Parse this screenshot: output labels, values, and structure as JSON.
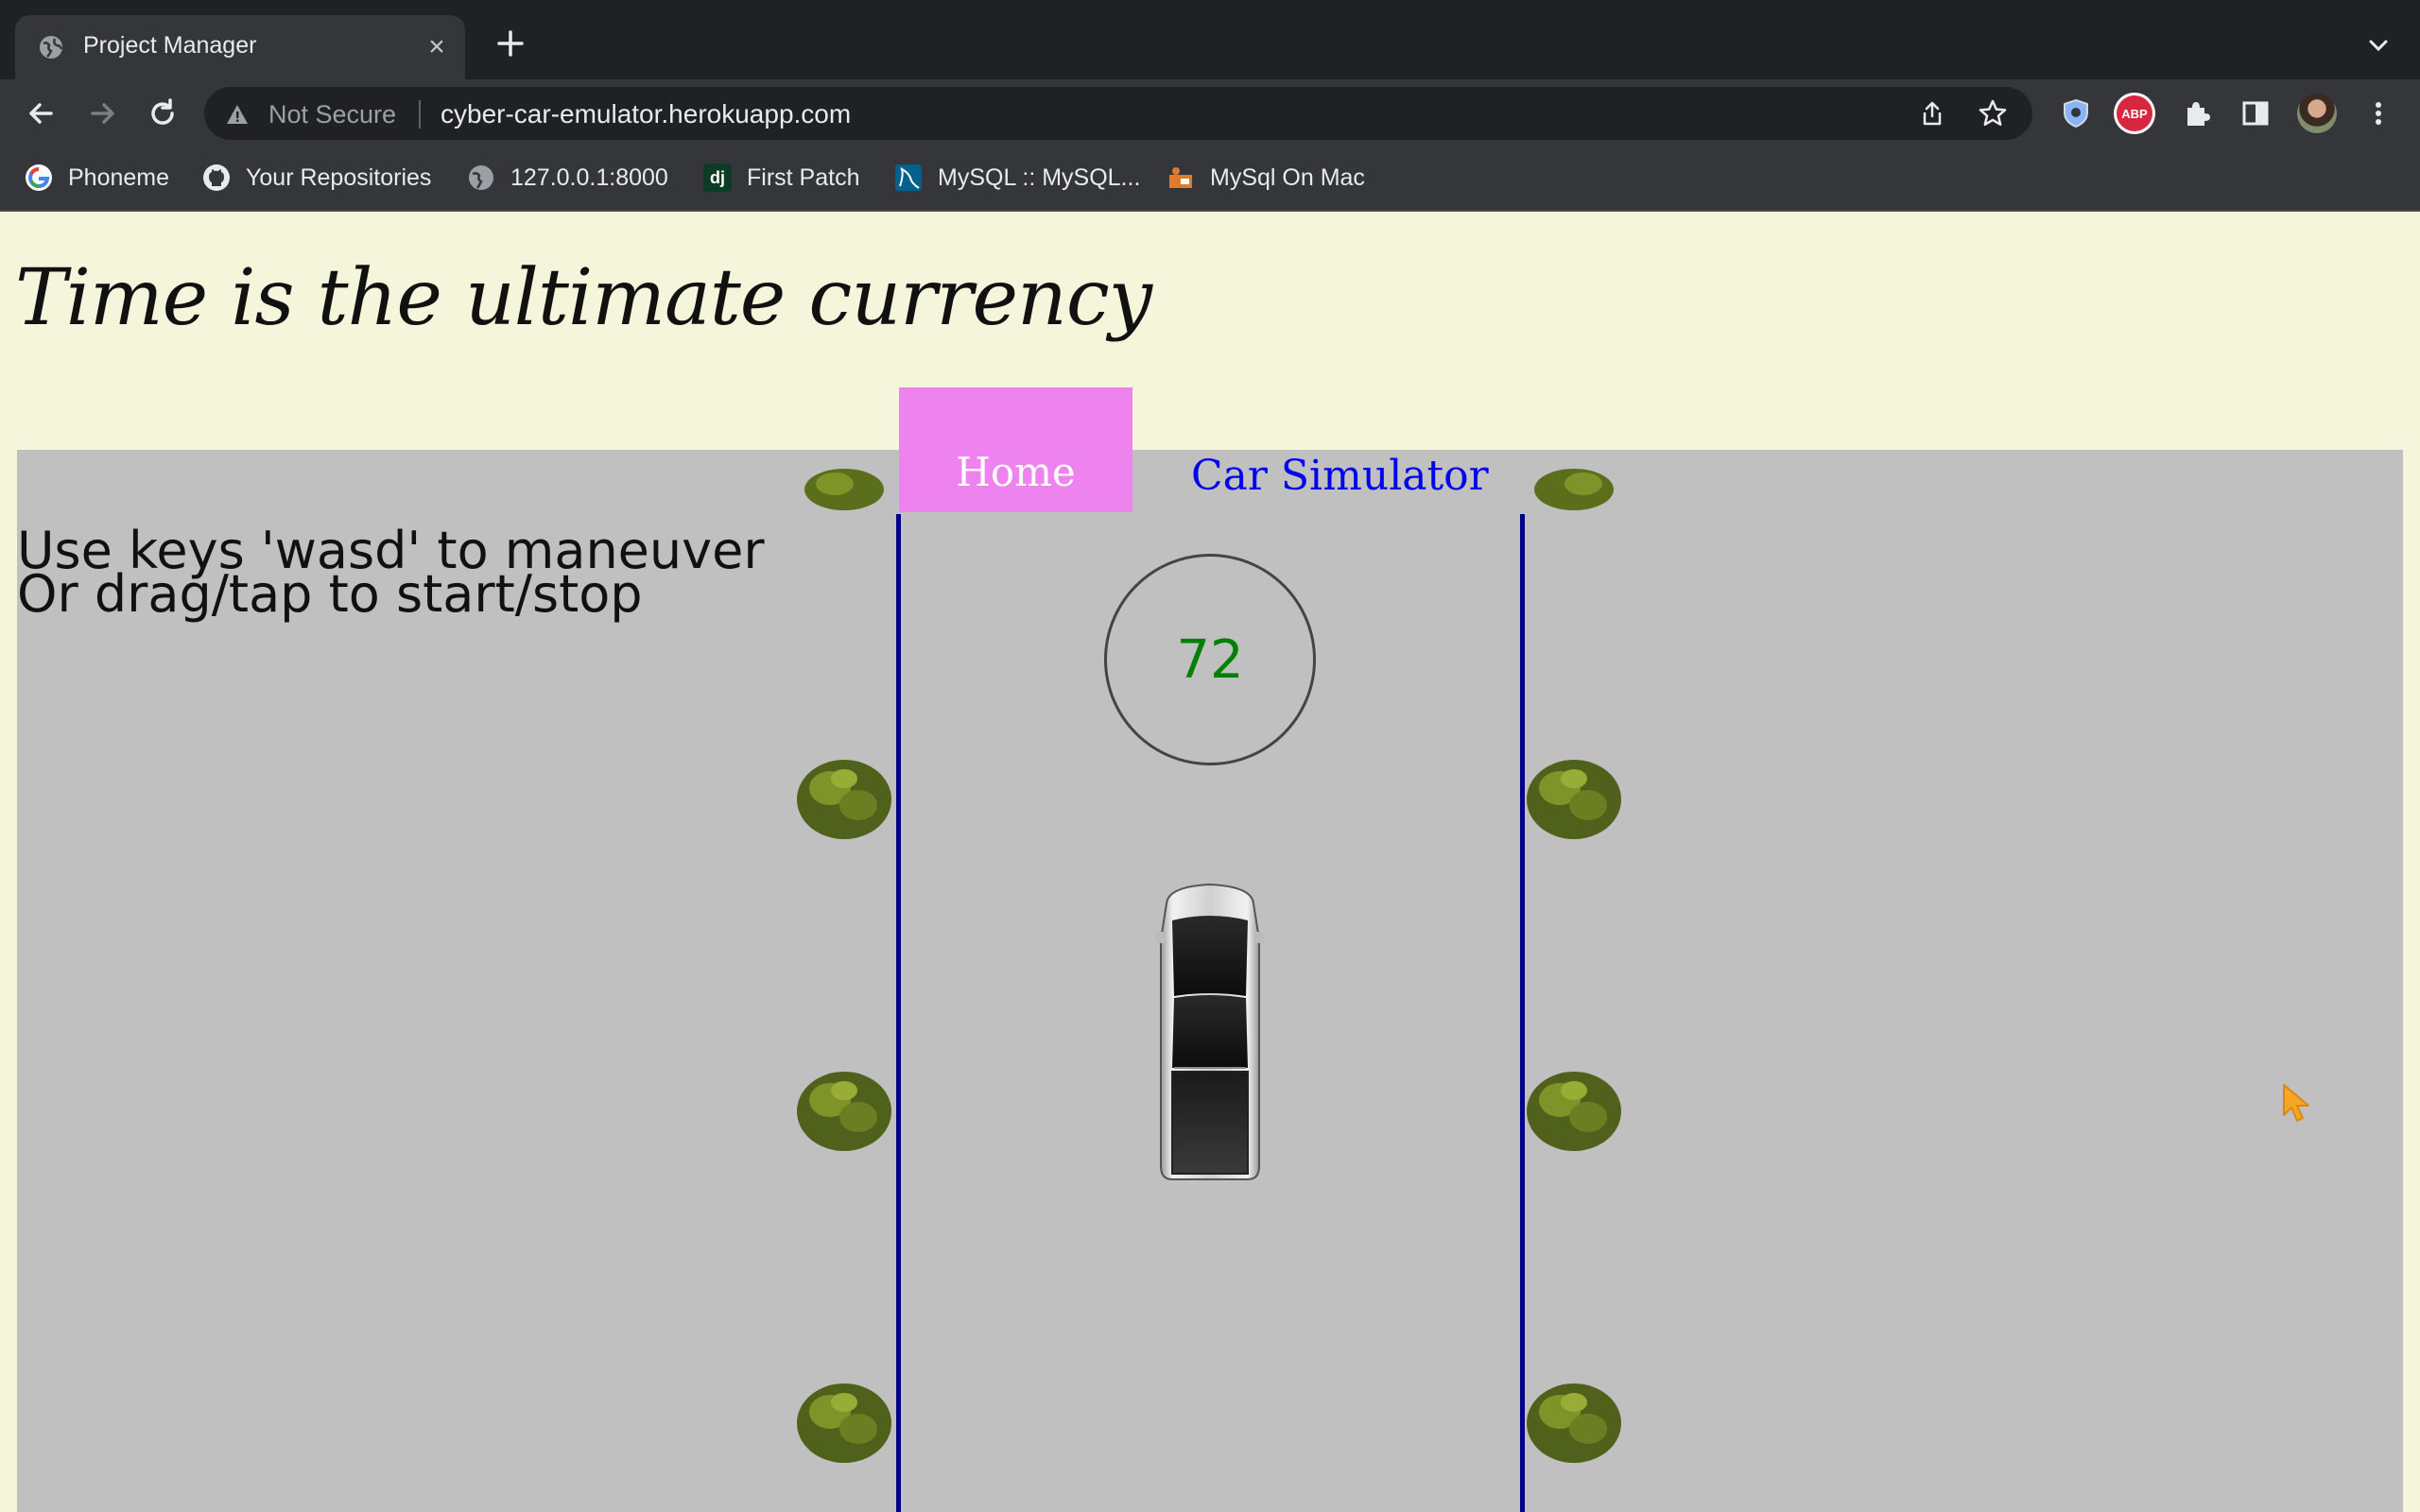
{
  "browser": {
    "tab_title": "Project Manager",
    "security_label": "Not Secure",
    "url": "cyber-car-emulator.herokuapp.com",
    "extension_abp_label": "ABP",
    "bookmarks": [
      {
        "label": "Phoneme",
        "icon": "google-icon"
      },
      {
        "label": "Your Repositories",
        "icon": "github-icon"
      },
      {
        "label": "127.0.0.1:8000",
        "icon": "globe-icon"
      },
      {
        "label": "First Patch",
        "icon": "django-icon"
      },
      {
        "label": "MySQL :: MySQL...",
        "icon": "mysql-icon"
      },
      {
        "label": "MySql On Mac",
        "icon": "folder-person-icon"
      }
    ]
  },
  "page": {
    "heading": "Time is the ultimate currency",
    "nav": {
      "home": "Home",
      "car_simulator": "Car Simulator"
    },
    "instructions": {
      "line1": "Use keys 'wasd' to maneuver",
      "line2": "Or drag/tap to start/stop"
    },
    "speed": "72"
  },
  "colors": {
    "page_bg": "#f5f5dc",
    "game_bg": "#c0c0c0",
    "nav_active": "#ee82ee",
    "lane": "#00008b",
    "speed_text": "#008000",
    "link": "#0000ee"
  }
}
